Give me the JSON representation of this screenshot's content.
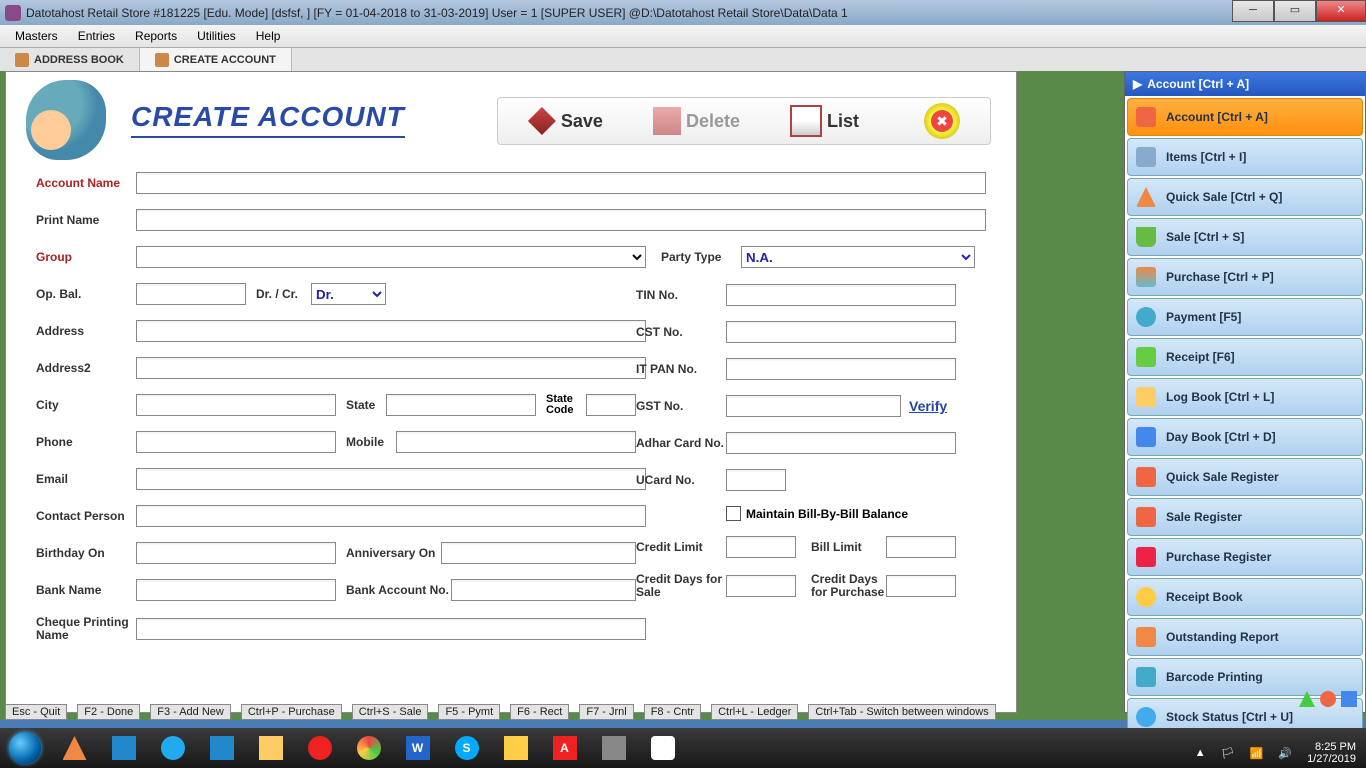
{
  "title": "Datotahost Retail Store #181225  [Edu. Mode]  [dsfsf, ] [FY = 01-04-2018 to 31-03-2019] User = 1 [SUPER USER]  @D:\\Datotahost Retail Store\\Data\\Data 1",
  "menu": {
    "masters": "Masters",
    "entries": "Entries",
    "reports": "Reports",
    "utilities": "Utilities",
    "help": "Help"
  },
  "tabs": {
    "addressbook": "ADDRESS BOOK",
    "createaccount": "CREATE ACCOUNT"
  },
  "form": {
    "title": "CREATE ACCOUNT",
    "save": "Save",
    "delete": "Delete",
    "list": "List",
    "accountName": "Account Name",
    "printName": "Print Name",
    "group": "Group",
    "partyType": "Party Type",
    "partyTypeVal": "N.A.",
    "opBal": "Op. Bal.",
    "drCr": "Dr. / Cr.",
    "drCrVal": "Dr.",
    "tinNo": "TIN No.",
    "address": "Address",
    "cstNo": "CST No.",
    "address2": "Address2",
    "itPanNo": "IT PAN No.",
    "city": "City",
    "state": "State",
    "stateCode": "State Code",
    "gstNo": "GST No.",
    "verify": "Verify",
    "phone": "Phone",
    "mobile": "Mobile",
    "adharCard": "Adhar Card No.",
    "email": "Email",
    "ucardNo": "UCard No.",
    "contactPerson": "Contact Person",
    "maintainBill": "Maintain Bill-By-Bill Balance",
    "birthday": "Birthday On",
    "anniversary": "Anniversary On",
    "creditLimit": "Credit Limit",
    "billLimit": "Bill Limit",
    "bankName": "Bank Name",
    "bankAcct": "Bank Account No.",
    "creditDaysSale": "Credit Days for Sale",
    "creditDaysPurchase": "Credit Days for Purchase",
    "chequeName": "Cheque Printing Name"
  },
  "sidebar": {
    "header": "Account [Ctrl + A]",
    "items": [
      {
        "label": "Account [Ctrl + A]"
      },
      {
        "label": "Items [Ctrl + I]"
      },
      {
        "label": "Quick Sale [Ctrl + Q]"
      },
      {
        "label": "Sale [Ctrl + S]"
      },
      {
        "label": "Purchase [Ctrl + P]"
      },
      {
        "label": "Payment [F5]"
      },
      {
        "label": "Receipt [F6]"
      },
      {
        "label": "Log Book [Ctrl + L]"
      },
      {
        "label": "Day Book [Ctrl + D]"
      },
      {
        "label": "Quick Sale Register"
      },
      {
        "label": "Sale Register"
      },
      {
        "label": "Purchase Register"
      },
      {
        "label": "Receipt Book"
      },
      {
        "label": "Outstanding Report"
      },
      {
        "label": "Barcode Printing"
      },
      {
        "label": "Stock Status [Ctrl + U]"
      }
    ]
  },
  "shortcuts": {
    "esc": "Esc - Quit",
    "f2": "F2 - Done",
    "f3": "F3 - Add New",
    "cp": "Ctrl+P - Purchase",
    "cs": "Ctrl+S - Sale",
    "f5": "F5 - Pymt",
    "f6": "F6 - Rect",
    "f7": "F7 - Jrnl",
    "f8": "F8 - Cntr",
    "cl": "Ctrl+L - Ledger",
    "ct": "Ctrl+Tab - Switch between windows"
  },
  "tray": {
    "time": "8:25 PM",
    "date": "1/27/2019"
  }
}
